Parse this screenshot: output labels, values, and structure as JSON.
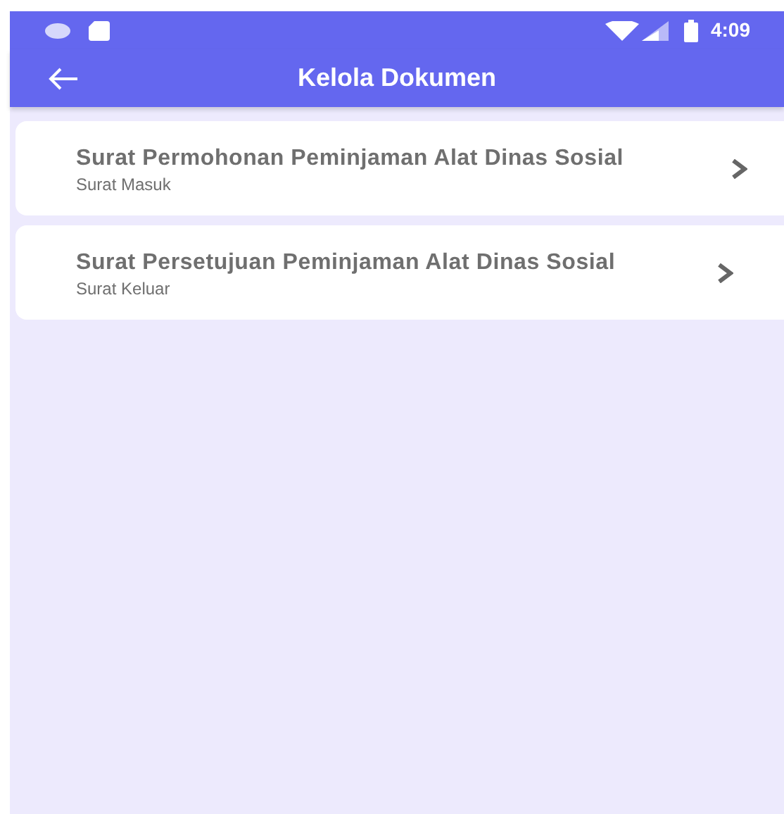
{
  "status_bar": {
    "time": "4:09"
  },
  "app_bar": {
    "title": "Kelola Dokumen"
  },
  "documents": [
    {
      "title": "Surat Permohonan Peminjaman Alat Dinas Sosial",
      "category": "Surat Masuk"
    },
    {
      "title": "Surat Persetujuan Peminjaman Alat Dinas Sosial",
      "category": "Surat Keluar"
    }
  ]
}
